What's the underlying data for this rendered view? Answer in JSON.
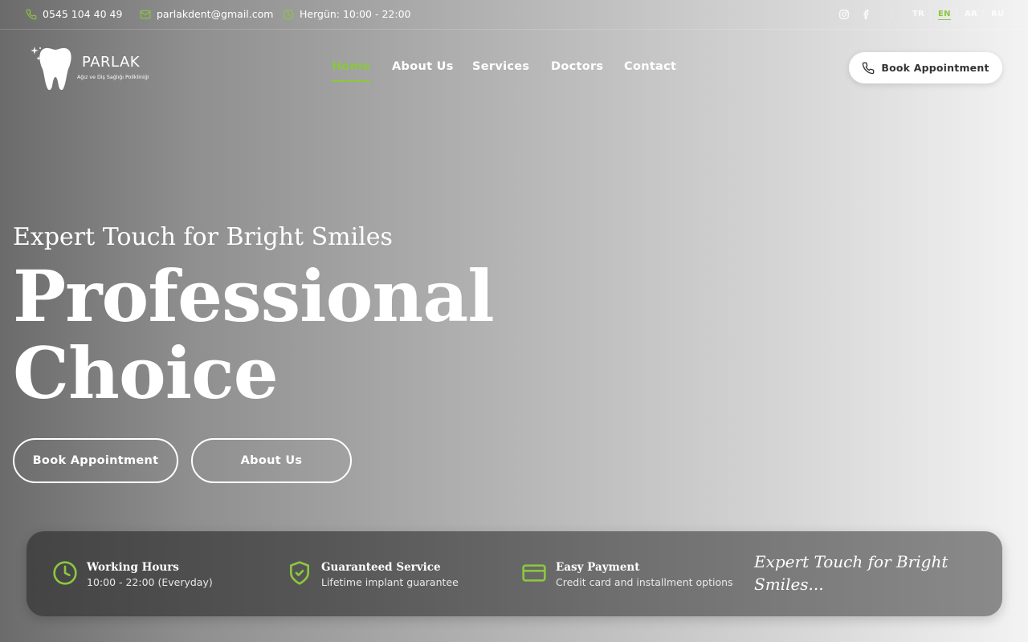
{
  "topbar": {
    "phone": "0545 104 40 49",
    "email": "parlakdent@gmail.com",
    "hours": "Hergün: 10:00 - 22:00",
    "languages": [
      "TR",
      "EN",
      "AR",
      "RU"
    ],
    "active_language": "EN"
  },
  "logo": {
    "name": "PARLAK",
    "subtitle": "Ağız ve Diş Sağlığı Polikliniği"
  },
  "nav": {
    "items": [
      "Home",
      "About Us",
      "Services",
      "Doctors",
      "Contact"
    ],
    "active": "Home"
  },
  "header_cta": "Book Appointment",
  "hero": {
    "subtitle": "Expert Touch for Bright Smiles",
    "title_line1": "Professional",
    "title_line2": "Choice",
    "primary_button": "Book Appointment",
    "secondary_button": "About Us"
  },
  "features": [
    {
      "title": "Working Hours",
      "desc": "10:00 - 22:00 (Everyday)",
      "icon": "clock-icon"
    },
    {
      "title": "Guaranteed Service",
      "desc": "Lifetime implant guarantee",
      "icon": "shield-check-icon"
    },
    {
      "title": "Easy Payment",
      "desc": "Credit card and installment options",
      "icon": "credit-card-icon"
    }
  ],
  "tagline": "Expert Touch for Bright Smiles...",
  "colors": {
    "accent": "#8cc63f",
    "text": "#ffffff",
    "button_bg": "#ffffff"
  }
}
